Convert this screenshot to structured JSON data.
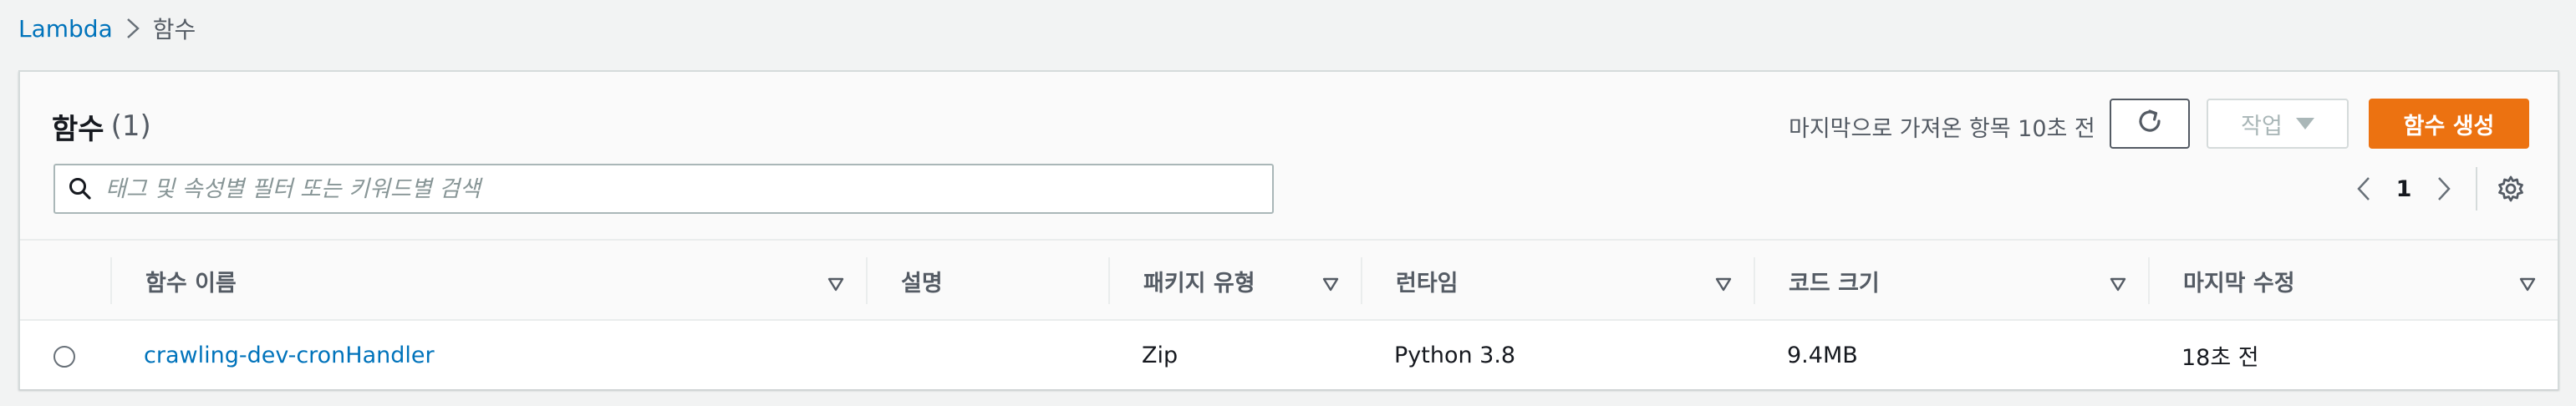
{
  "breadcrumb": {
    "root": "Lambda",
    "current": "함수"
  },
  "header": {
    "title": "함수",
    "count": "(1)",
    "last_fetched": "마지막으로 가져온 항목 10초 전",
    "actions_label": "작업",
    "create_label": "함수 생성"
  },
  "search": {
    "value": "",
    "placeholder": "태그 및 속성별 필터 또는 키워드별 검색"
  },
  "pagination": {
    "current_page": "1"
  },
  "table": {
    "columns": [
      "함수 이름",
      "설명",
      "패키지 유형",
      "런타임",
      "코드 크기",
      "마지막 수정"
    ],
    "rows": [
      {
        "name": "crawling-dev-cronHandler",
        "description": "",
        "package_type": "Zip",
        "runtime": "Python 3.8",
        "code_size": "9.4MB",
        "last_modified": "18초 전"
      }
    ]
  },
  "colors": {
    "accent": "#ec7211",
    "link": "#0073bb",
    "background": "#f2f3f3"
  },
  "icons": [
    "chevron-right-icon",
    "refresh-icon",
    "caret-down-icon",
    "search-icon",
    "chevron-left-icon",
    "gear-icon",
    "sort-icon",
    "radio-icon"
  ]
}
